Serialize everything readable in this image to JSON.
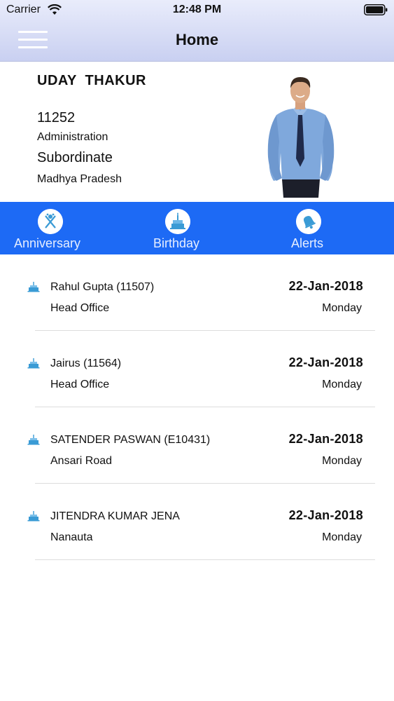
{
  "status_bar": {
    "carrier": "Carrier",
    "time": "12:48 PM"
  },
  "nav": {
    "title": "Home",
    "menu_icon": "hamburger-menu-icon"
  },
  "profile": {
    "name": "UDAY  THAKUR",
    "employee_id": "11252",
    "department": "Administration",
    "role": "Subordinate",
    "location": "Madhya Pradesh"
  },
  "tabs": [
    {
      "label": "Anniversary",
      "icon": "anniversary-icon"
    },
    {
      "label": "Birthday",
      "icon": "birthday-cake-icon"
    },
    {
      "label": "Alerts",
      "icon": "bell-icon"
    }
  ],
  "list": [
    {
      "name": "Rahul  Gupta (11507)",
      "office": "Head Office",
      "date": "22-Jan-2018",
      "day": "Monday"
    },
    {
      "name": "Jairus (11564)",
      "office": "Head Office",
      "date": "22-Jan-2018",
      "day": "Monday"
    },
    {
      "name": "SATENDER PASWAN (E10431)",
      "office": "Ansari Road",
      "date": "22-Jan-2018",
      "day": "Monday"
    },
    {
      "name": "JITENDRA KUMAR JENA",
      "office": "Nanauta",
      "date": "22-Jan-2018",
      "day": "Monday"
    }
  ],
  "colors": {
    "tab_bar": "#1d6af5",
    "nav_gradient_top": "#e9ecfb",
    "nav_gradient_bottom": "#c9d0f1",
    "cake_icon": "#3a9bd5"
  }
}
